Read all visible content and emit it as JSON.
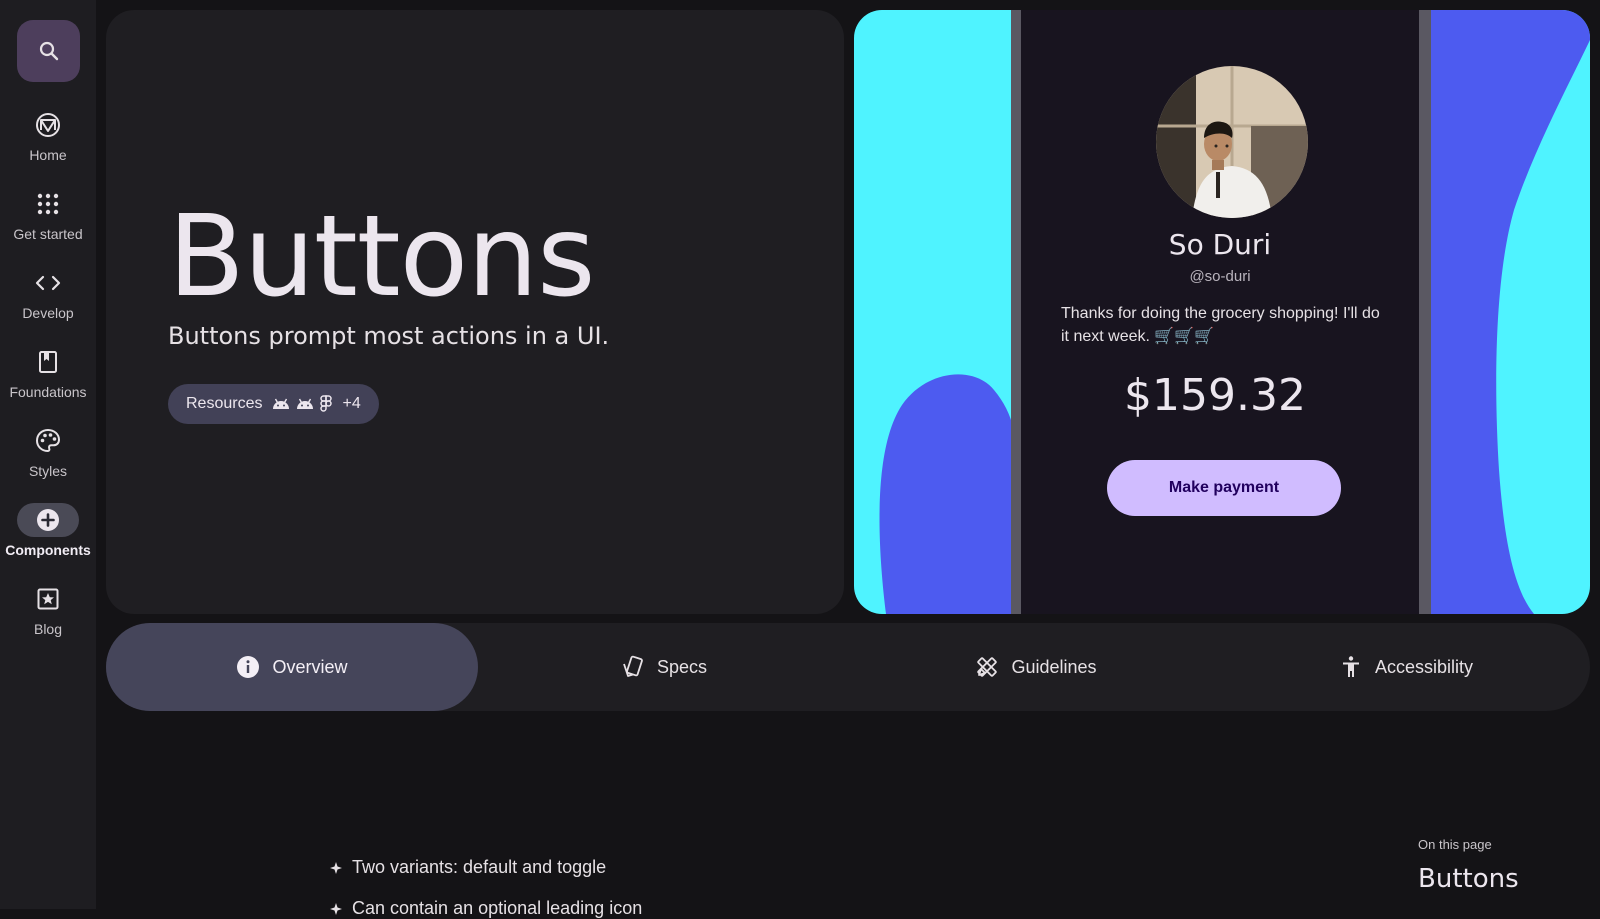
{
  "nav": {
    "search_label": "Search",
    "items": [
      {
        "label": "Home",
        "icon": "material-logo-icon"
      },
      {
        "label": "Get started",
        "icon": "apps-grid-icon"
      },
      {
        "label": "Develop",
        "icon": "code-icon"
      },
      {
        "label": "Foundations",
        "icon": "book-icon"
      },
      {
        "label": "Styles",
        "icon": "palette-icon"
      },
      {
        "label": "Components",
        "icon": "add-circle-icon",
        "active": true
      },
      {
        "label": "Blog",
        "icon": "star-doc-icon"
      }
    ]
  },
  "hero": {
    "title": "Buttons",
    "subtitle": "Buttons prompt most actions in a UI.",
    "resources_label": "Resources",
    "resources_more": "+4",
    "resource_icons": [
      "android-icon",
      "android-icon",
      "figma-icon"
    ]
  },
  "profile": {
    "name": "So Duri",
    "handle": "@so-duri",
    "message": "Thanks for doing the grocery shopping! I'll do it next week. 🛒🛒🛒",
    "amount": "$159.32",
    "button_label": "Make payment"
  },
  "tabs": [
    {
      "label": "Overview",
      "icon": "info-icon",
      "active": true
    },
    {
      "label": "Specs",
      "icon": "specs-icon"
    },
    {
      "label": "Guidelines",
      "icon": "guidelines-icon"
    },
    {
      "label": "Accessibility",
      "icon": "accessibility-icon"
    }
  ],
  "content": {
    "bullets": [
      "Two variants: default and toggle",
      "Can contain an optional leading icon"
    ]
  },
  "on_this_page": {
    "label": "On this page",
    "title": "Buttons"
  },
  "colors": {
    "background": "#141316",
    "surface": "#1f1e22",
    "rail": "#1e1d21",
    "accent_cyan": "#4ff3ff",
    "accent_blue": "#4d5bf0",
    "button_primary": "#d0bcff",
    "tab_active": "#45455a"
  }
}
